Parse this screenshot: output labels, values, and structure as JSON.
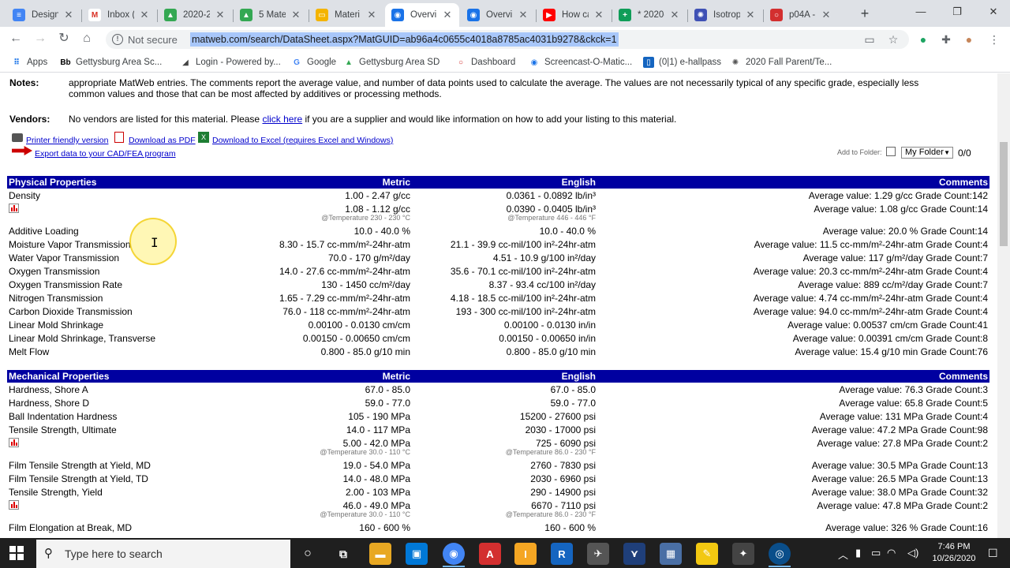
{
  "browser": {
    "tabs": [
      {
        "title": "Design",
        "fav_color": "#4285f4",
        "fav": "≡"
      },
      {
        "title": "Inbox (",
        "fav_color": "#ffffff",
        "fav": "M"
      },
      {
        "title": "2020-2",
        "fav_color": "#34a853",
        "fav": "▲"
      },
      {
        "title": "5 Mate",
        "fav_color": "#34a853",
        "fav": "▲"
      },
      {
        "title": "Materi",
        "fav_color": "#f4b400",
        "fav": "▭"
      },
      {
        "title": "Overvi",
        "fav_color": "#1a73e8",
        "fav": "◉"
      },
      {
        "title": "Overvi",
        "fav_color": "#1a73e8",
        "fav": "◉"
      },
      {
        "title": "How ca",
        "fav_color": "#ff0000",
        "fav": "▶"
      },
      {
        "title": "* 2020-",
        "fav_color": "#0f9d58",
        "fav": "+"
      },
      {
        "title": "Isotrop",
        "fav_color": "#3f51b5",
        "fav": "✺"
      },
      {
        "title": "p04A -",
        "fav_color": "#d32f2f",
        "fav": "○"
      }
    ],
    "active_tab": 5,
    "security_label": "Not secure",
    "url": "matweb.com/search/DataSheet.aspx?MatGUID=ab96a4c0655c4018a8785ac4031b9278&ckck=1",
    "bookmarks": [
      {
        "label": "Apps",
        "icon": "apps-icon"
      },
      {
        "label": "Gettysburg Area Sc...",
        "icon": "bb-icon"
      },
      {
        "label": "Login - Powered by...",
        "icon": "powered-icon"
      },
      {
        "label": "Google",
        "icon": "google-icon"
      },
      {
        "label": "Gettysburg Area SD",
        "icon": "drive-icon"
      },
      {
        "label": "Dashboard",
        "icon": "dashboard-icon"
      },
      {
        "label": "Screencast-O-Matic...",
        "icon": "screencast-icon"
      },
      {
        "label": "(0|1) e-hallpass",
        "icon": "ehallpass-icon"
      },
      {
        "label": "2020 Fall Parent/Te...",
        "icon": "spinner-icon"
      }
    ]
  },
  "page": {
    "notes_label": "Notes:",
    "notes_line1": "appropriate MatWeb entries. The comments report the average value, and number of data points used to calculate the average. The values are not necessarily typical of any specific grade, especially less",
    "notes_line2": "common values and those that can be most affected by additives or processing methods.",
    "vendors_label": "Vendors:",
    "vendors_pre": "No vendors are listed for this material. Please ",
    "vendors_link": "click here",
    "vendors_post": " if you are a supplier and would like information on how to add your listing to this material.",
    "printer_link": "Printer friendly version",
    "pdf_link": "Download as PDF",
    "excel_link": "Download to Excel (requires Excel and Windows)",
    "export_link": "Export data to your CAD/FEA program",
    "add_to_folder": "Add to Folder:",
    "folder_select": "My Folder",
    "folder_count": "0/0",
    "col_metric": "Metric",
    "col_english": "English",
    "col_comments": "Comments",
    "physical": {
      "title": "Physical Properties",
      "rows": [
        {
          "name": "Density",
          "metric": "1.00 - 2.47 g/cc",
          "english": "0.0361 - 0.0892 lb/in³",
          "comment": "Average value: 1.29 g/cc Grade Count:142"
        },
        {
          "name": "",
          "chart": true,
          "metric": "1.08 - 1.12 g/cc",
          "metric_sub": "@Temperature 230 - 230 °C",
          "english": "0.0390 - 0.0405 lb/in³",
          "english_sub": "@Temperature 446 - 446 °F",
          "comment": "Average value: 1.08 g/cc Grade Count:14"
        },
        {
          "name": "Additive Loading",
          "metric": "10.0 - 40.0 %",
          "english": "10.0 - 40.0 %",
          "comment": "Average value: 20.0 % Grade Count:14"
        },
        {
          "name": "Moisture Vapor Transmission",
          "metric": "8.30 - 15.7 cc-mm/m²-24hr-atm",
          "english": "21.1 - 39.9 cc-mil/100 in²-24hr-atm",
          "comment": "Average value: 11.5 cc-mm/m²-24hr-atm Grade Count:4"
        },
        {
          "name": "Water Vapor Transmission",
          "metric": "70.0 - 170 g/m²/day",
          "english": "4.51 - 10.9 g/100 in²/day",
          "comment": "Average value: 117 g/m²/day Grade Count:7"
        },
        {
          "name": "Oxygen Transmission",
          "metric": "14.0 - 27.6 cc-mm/m²-24hr-atm",
          "english": "35.6 - 70.1 cc-mil/100 in²-24hr-atm",
          "comment": "Average value: 20.3 cc-mm/m²-24hr-atm Grade Count:4"
        },
        {
          "name": "Oxygen Transmission Rate",
          "metric": "130 - 1450 cc/m²/day",
          "english": "8.37 - 93.4 cc/100 in²/day",
          "comment": "Average value: 889 cc/m²/day Grade Count:7"
        },
        {
          "name": "Nitrogen Transmission",
          "metric": "1.65 - 7.29 cc-mm/m²-24hr-atm",
          "english": "4.18 - 18.5 cc-mil/100 in²-24hr-atm",
          "comment": "Average value: 4.74 cc-mm/m²-24hr-atm Grade Count:4"
        },
        {
          "name": "Carbon Dioxide Transmission",
          "metric": "76.0 - 118 cc-mm/m²-24hr-atm",
          "english": "193 - 300 cc-mil/100 in²-24hr-atm",
          "comment": "Average value: 94.0 cc-mm/m²-24hr-atm Grade Count:4"
        },
        {
          "name": "Linear Mold Shrinkage",
          "metric": "0.00100 - 0.0130 cm/cm",
          "english": "0.00100 - 0.0130 in/in",
          "comment": "Average value: 0.00537 cm/cm Grade Count:41"
        },
        {
          "name": "Linear Mold Shrinkage, Transverse",
          "metric": "0.00150 - 0.00650 cm/cm",
          "english": "0.00150 - 0.00650 in/in",
          "comment": "Average value: 0.00391 cm/cm Grade Count:8"
        },
        {
          "name": "Melt Flow",
          "metric": "0.800 - 85.0 g/10 min",
          "english": "0.800 - 85.0 g/10 min",
          "comment": "Average value: 15.4 g/10 min Grade Count:76"
        }
      ]
    },
    "mechanical": {
      "title": "Mechanical Properties",
      "rows": [
        {
          "name": "Hardness, Shore A",
          "metric": "67.0 - 85.0",
          "english": "67.0 - 85.0",
          "comment": "Average value: 76.3 Grade Count:3"
        },
        {
          "name": "Hardness, Shore D",
          "metric": "59.0 - 77.0",
          "english": "59.0 - 77.0",
          "comment": "Average value: 65.8 Grade Count:5"
        },
        {
          "name": "Ball Indentation Hardness",
          "metric": "105 - 190 MPa",
          "english": "15200 - 27600 psi",
          "comment": "Average value: 131 MPa Grade Count:4"
        },
        {
          "name": "Tensile Strength, Ultimate",
          "metric": "14.0 - 117 MPa",
          "english": "2030 - 17000 psi",
          "comment": "Average value: 47.2 MPa Grade Count:98"
        },
        {
          "name": "",
          "chart": true,
          "metric": "5.00 - 42.0 MPa",
          "metric_sub": "@Temperature 30.0 - 110 °C",
          "english": "725 - 6090 psi",
          "english_sub": "@Temperature 86.0 - 230 °F",
          "comment": "Average value: 27.8 MPa Grade Count:2"
        },
        {
          "name": "Film Tensile Strength at Yield, MD",
          "metric": "19.0 - 54.0 MPa",
          "english": "2760 - 7830 psi",
          "comment": "Average value: 30.5 MPa Grade Count:13"
        },
        {
          "name": "Film Tensile Strength at Yield, TD",
          "metric": "14.0 - 48.0 MPa",
          "english": "2030 - 6960 psi",
          "comment": "Average value: 26.5 MPa Grade Count:13"
        },
        {
          "name": "Tensile Strength, Yield",
          "metric": "2.00 - 103 MPa",
          "english": "290 - 14900 psi",
          "comment": "Average value: 38.0 MPa Grade Count:32"
        },
        {
          "name": "",
          "chart": true,
          "metric": "46.0 - 49.0 MPa",
          "metric_sub": "@Temperature 30.0 - 110 °C",
          "english": "6670 - 7110 psi",
          "english_sub": "@Temperature 86.0 - 230 °F",
          "comment": "Average value: 47.8 MPa Grade Count:2"
        },
        {
          "name": "Film Elongation at Break, MD",
          "metric": "160 - 600 %",
          "english": "160 - 600 %",
          "comment": "Average value: 326 % Grade Count:16"
        }
      ]
    }
  },
  "taskbar": {
    "search_placeholder": "Type here to search",
    "time": "7:46 PM",
    "date": "10/26/2020"
  }
}
